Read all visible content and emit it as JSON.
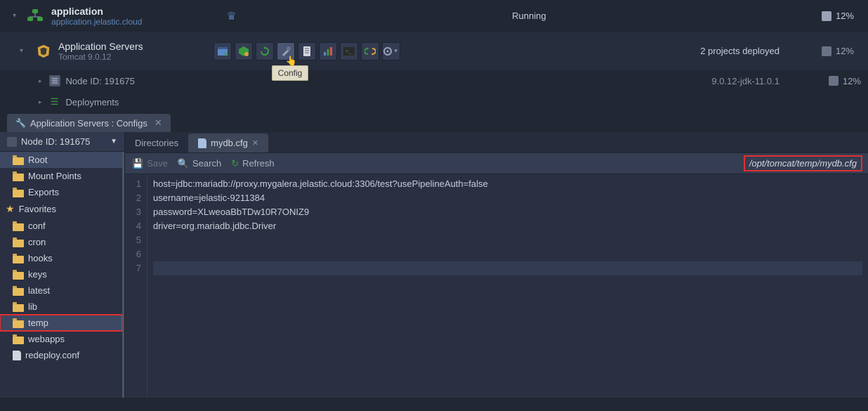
{
  "env": {
    "title": "application",
    "subtitle": "application.jelastic.cloud",
    "status": "Running",
    "usage": "12%"
  },
  "appServer": {
    "title": "Application Servers",
    "subtitle": "Tomcat 9.0.12",
    "deployInfo": "2 projects deployed",
    "usage": "12%",
    "tooltip": "Config"
  },
  "nodeRow": {
    "label": "Node ID: 191675",
    "version": "9.0.12-jdk-11.0.1",
    "usage": "12%"
  },
  "deployments": {
    "label": "Deployments"
  },
  "configTab": {
    "label": "Application Servers : Configs"
  },
  "sidebar": {
    "header": "Node ID: 191675",
    "root": "Root",
    "mount": "Mount Points",
    "exports": "Exports",
    "favorites": "Favorites",
    "items": [
      "conf",
      "cron",
      "hooks",
      "keys",
      "latest",
      "lib",
      "temp",
      "webapps"
    ],
    "file": "redeploy.conf"
  },
  "fileTabs": {
    "directories": "Directories",
    "active": "mydb.cfg"
  },
  "actions": {
    "save": "Save",
    "search": "Search",
    "refresh": "Refresh",
    "path": "/opt/tomcat/temp/mydb.cfg"
  },
  "editor": {
    "lines": [
      "host=jdbc:mariadb://proxy.mygalera.jelastic.cloud:3306/test?usePipelineAuth=false",
      "username=jelastic-9211384",
      "password=XLweoaBbTDw10R7ONIZ9",
      "driver=org.mariadb.jdbc.Driver",
      "",
      "",
      ""
    ]
  }
}
